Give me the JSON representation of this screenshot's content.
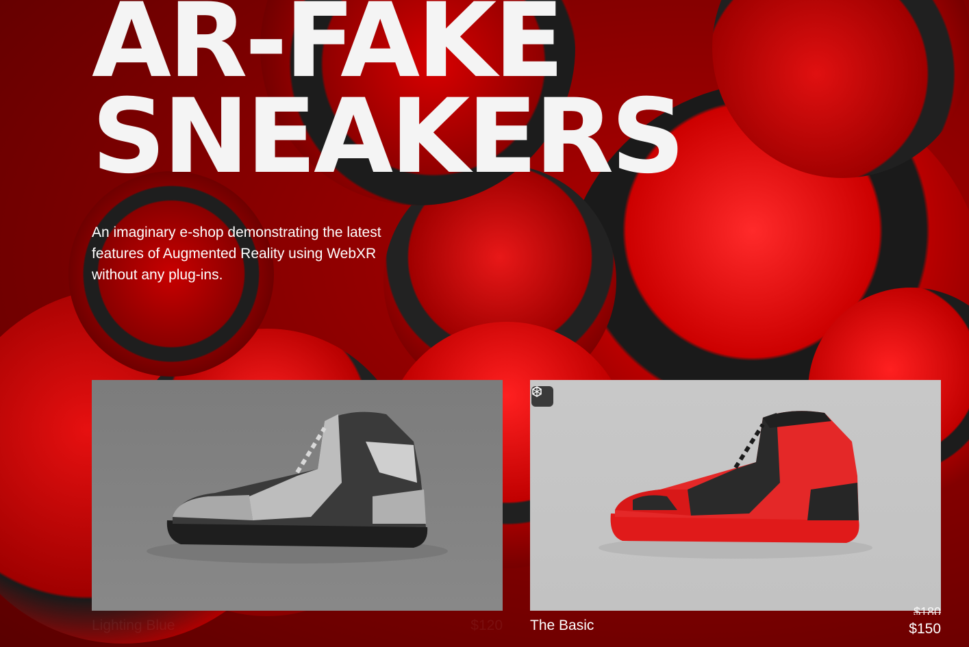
{
  "hero": {
    "title_line1": "AR-FAKE",
    "title_line2": "SNEAKERS",
    "description": "An imaginary e-shop demonstrating the latest features of Augmented Reality using WebXR without any plug-ins."
  },
  "products": [
    {
      "name": "Lighting Blue",
      "price": "$120"
    },
    {
      "name": "The Basic",
      "price_old": "$180",
      "price": "$150",
      "badge_icon": "ar-cube-icon"
    }
  ],
  "colors": {
    "background": "#8a0000",
    "accent_red": "#e11414",
    "text": "#ffffff"
  }
}
